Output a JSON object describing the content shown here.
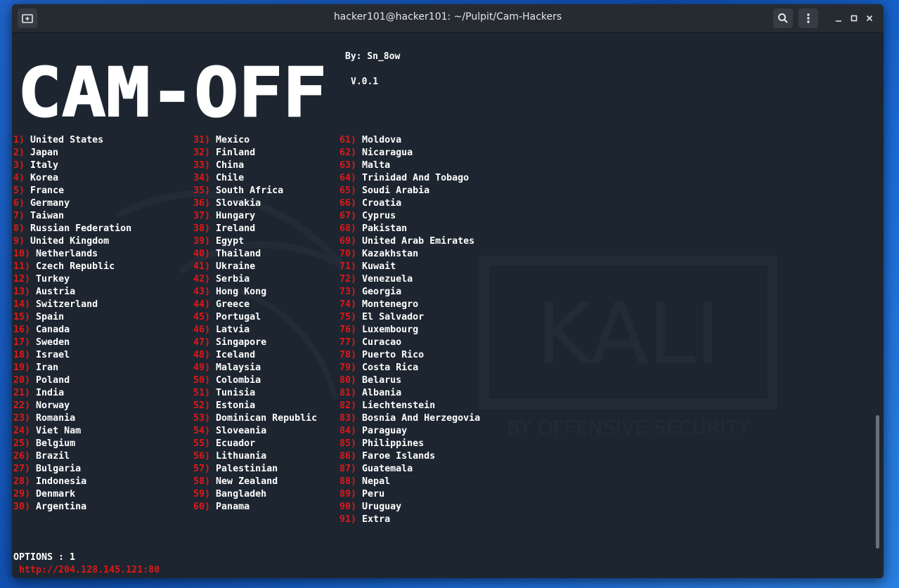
{
  "window": {
    "title": "hacker101@hacker101: ~/Pulpit/Cam-Hackers"
  },
  "banner": {
    "logo_text": "CAM-OFF",
    "author": "By: Sn_8ow",
    "version": "V.0.1"
  },
  "watermark": {
    "brand": "KALI",
    "tagline": "BY OFFENSIVE SECURITY"
  },
  "countries": {
    "col1": [
      {
        "num": "1)",
        "name": "United States"
      },
      {
        "num": "2)",
        "name": "Japan"
      },
      {
        "num": "3)",
        "name": "Italy"
      },
      {
        "num": "4)",
        "name": "Korea"
      },
      {
        "num": "5)",
        "name": "France"
      },
      {
        "num": "6)",
        "name": "Germany"
      },
      {
        "num": "7)",
        "name": "Taiwan"
      },
      {
        "num": "8)",
        "name": "Russian Federation"
      },
      {
        "num": "9)",
        "name": "United Kingdom"
      },
      {
        "num": "10)",
        "name": "Netherlands"
      },
      {
        "num": "11)",
        "name": "Czech Republic"
      },
      {
        "num": "12)",
        "name": "Turkey"
      },
      {
        "num": "13)",
        "name": "Austria"
      },
      {
        "num": "14)",
        "name": "Switzerland"
      },
      {
        "num": "15)",
        "name": "Spain"
      },
      {
        "num": "16)",
        "name": "Canada"
      },
      {
        "num": "17)",
        "name": "Sweden"
      },
      {
        "num": "18)",
        "name": "Israel"
      },
      {
        "num": "19)",
        "name": "Iran"
      },
      {
        "num": "20)",
        "name": "Poland"
      },
      {
        "num": "21)",
        "name": "India"
      },
      {
        "num": "22)",
        "name": "Norway"
      },
      {
        "num": "23)",
        "name": "Romania"
      },
      {
        "num": "24)",
        "name": "Viet Nam"
      },
      {
        "num": "25)",
        "name": "Belgium"
      },
      {
        "num": "26)",
        "name": "Brazil"
      },
      {
        "num": "27)",
        "name": "Bulgaria"
      },
      {
        "num": "28)",
        "name": "Indonesia"
      },
      {
        "num": "29)",
        "name": "Denmark"
      },
      {
        "num": "30)",
        "name": "Argentina"
      }
    ],
    "col2": [
      {
        "num": "31)",
        "name": "Mexico"
      },
      {
        "num": "32)",
        "name": "Finland"
      },
      {
        "num": "33)",
        "name": "China"
      },
      {
        "num": "34)",
        "name": "Chile"
      },
      {
        "num": "35)",
        "name": "South Africa"
      },
      {
        "num": "36)",
        "name": "Slovakia"
      },
      {
        "num": "37)",
        "name": "Hungary"
      },
      {
        "num": "38)",
        "name": "Ireland"
      },
      {
        "num": "39)",
        "name": "Egypt"
      },
      {
        "num": "40)",
        "name": "Thailand"
      },
      {
        "num": "41)",
        "name": "Ukraine"
      },
      {
        "num": "42)",
        "name": "Serbia"
      },
      {
        "num": "43)",
        "name": "Hong Kong"
      },
      {
        "num": "44)",
        "name": "Greece"
      },
      {
        "num": "45)",
        "name": "Portugal"
      },
      {
        "num": "46)",
        "name": "Latvia"
      },
      {
        "num": "47)",
        "name": "Singapore"
      },
      {
        "num": "48)",
        "name": "Iceland"
      },
      {
        "num": "49)",
        "name": "Malaysia"
      },
      {
        "num": "50)",
        "name": "Colombia"
      },
      {
        "num": "51)",
        "name": "Tunisia"
      },
      {
        "num": "52)",
        "name": "Estonia"
      },
      {
        "num": "53)",
        "name": "Dominican Republic"
      },
      {
        "num": "54)",
        "name": "Sloveania"
      },
      {
        "num": "55)",
        "name": "Ecuador"
      },
      {
        "num": "56)",
        "name": "Lithuania"
      },
      {
        "num": "57)",
        "name": "Palestinian"
      },
      {
        "num": "58)",
        "name": "New Zealand"
      },
      {
        "num": "59)",
        "name": "Bangladeh"
      },
      {
        "num": "60)",
        "name": "Panama"
      }
    ],
    "col3": [
      {
        "num": "61)",
        "name": "Moldova"
      },
      {
        "num": "62)",
        "name": "Nicaragua"
      },
      {
        "num": "63)",
        "name": "Malta"
      },
      {
        "num": "64)",
        "name": "Trinidad And Tobago"
      },
      {
        "num": "65)",
        "name": "Soudi Arabia"
      },
      {
        "num": "66)",
        "name": "Croatia"
      },
      {
        "num": "67)",
        "name": "Cyprus"
      },
      {
        "num": "68)",
        "name": "Pakistan"
      },
      {
        "num": "69)",
        "name": "United Arab Emirates"
      },
      {
        "num": "70)",
        "name": "Kazakhstan"
      },
      {
        "num": "71)",
        "name": "Kuwait"
      },
      {
        "num": "72)",
        "name": "Venezuela"
      },
      {
        "num": "73)",
        "name": "Georgia"
      },
      {
        "num": "74)",
        "name": "Montenegro"
      },
      {
        "num": "75)",
        "name": "El Salvador"
      },
      {
        "num": "76)",
        "name": "Luxembourg"
      },
      {
        "num": "77)",
        "name": "Curacao"
      },
      {
        "num": "78)",
        "name": "Puerto Rico"
      },
      {
        "num": "79)",
        "name": "Costa Rica"
      },
      {
        "num": "80)",
        "name": "Belarus"
      },
      {
        "num": "81)",
        "name": "Albania"
      },
      {
        "num": "82)",
        "name": "Liechtenstein"
      },
      {
        "num": "83)",
        "name": "Bosnia And Herzegovia"
      },
      {
        "num": "84)",
        "name": "Paraguay"
      },
      {
        "num": "85)",
        "name": "Philippines"
      },
      {
        "num": "86)",
        "name": "Faroe Islands"
      },
      {
        "num": "87)",
        "name": "Guatemala"
      },
      {
        "num": "88)",
        "name": "Nepal"
      },
      {
        "num": "89)",
        "name": "Peru"
      },
      {
        "num": "90)",
        "name": "Uruguay"
      },
      {
        "num": "91)",
        "name": "Extra"
      }
    ]
  },
  "prompt": {
    "options_line": "OPTIONS : 1",
    "result_url": "http://204.128.145.121:80"
  },
  "colors": {
    "number": "#e01818",
    "text": "#ffffff",
    "terminal_bg": "#1d2630",
    "titlebar_bg": "#262b31"
  }
}
